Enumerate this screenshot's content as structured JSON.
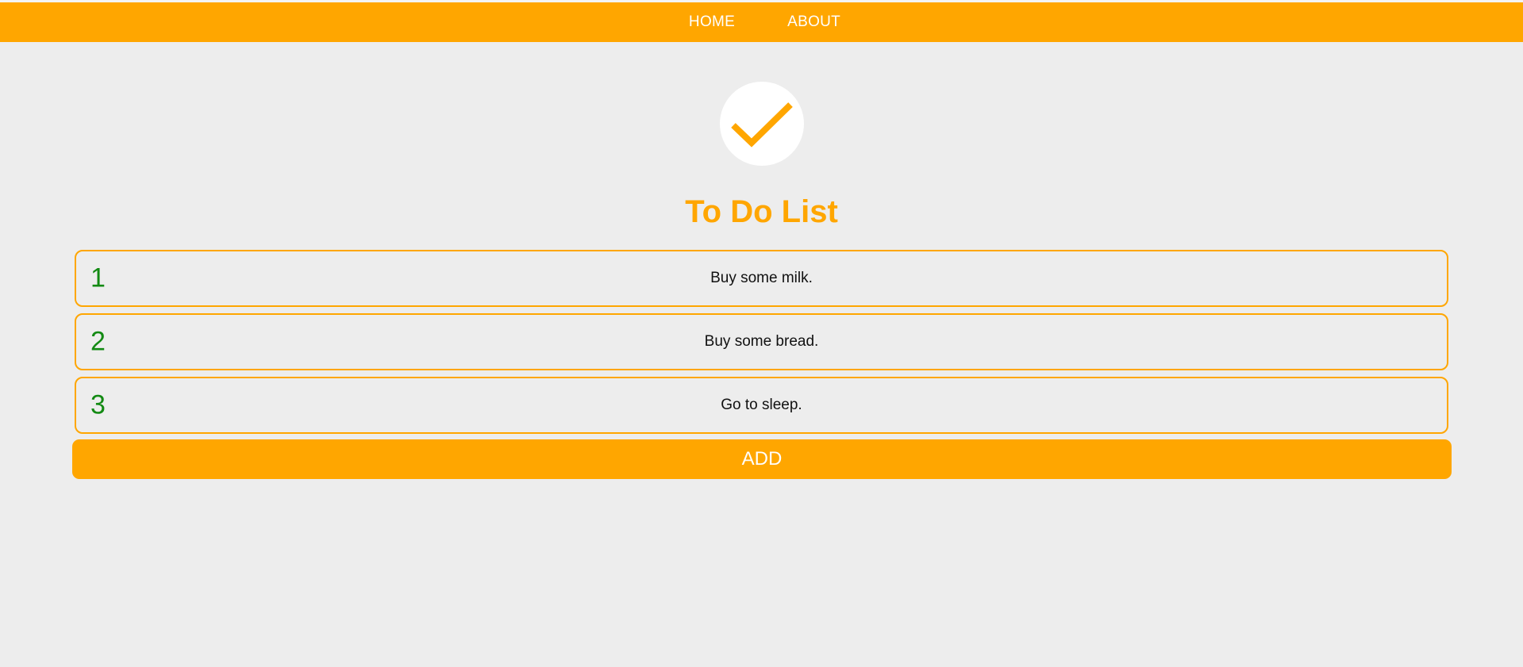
{
  "nav": {
    "home_label": "HOME",
    "about_label": "ABOUT"
  },
  "logo": {
    "icon": "checkmark-icon"
  },
  "title": "To Do List",
  "todos": [
    {
      "index": "1",
      "text": "Buy some milk."
    },
    {
      "index": "2",
      "text": "Buy some bread."
    },
    {
      "index": "3",
      "text": "Go to sleep."
    }
  ],
  "add_button_label": "ADD",
  "colors": {
    "accent": "#ffa600",
    "background": "#ededed",
    "index_green": "#138a13",
    "text": "#111111"
  }
}
